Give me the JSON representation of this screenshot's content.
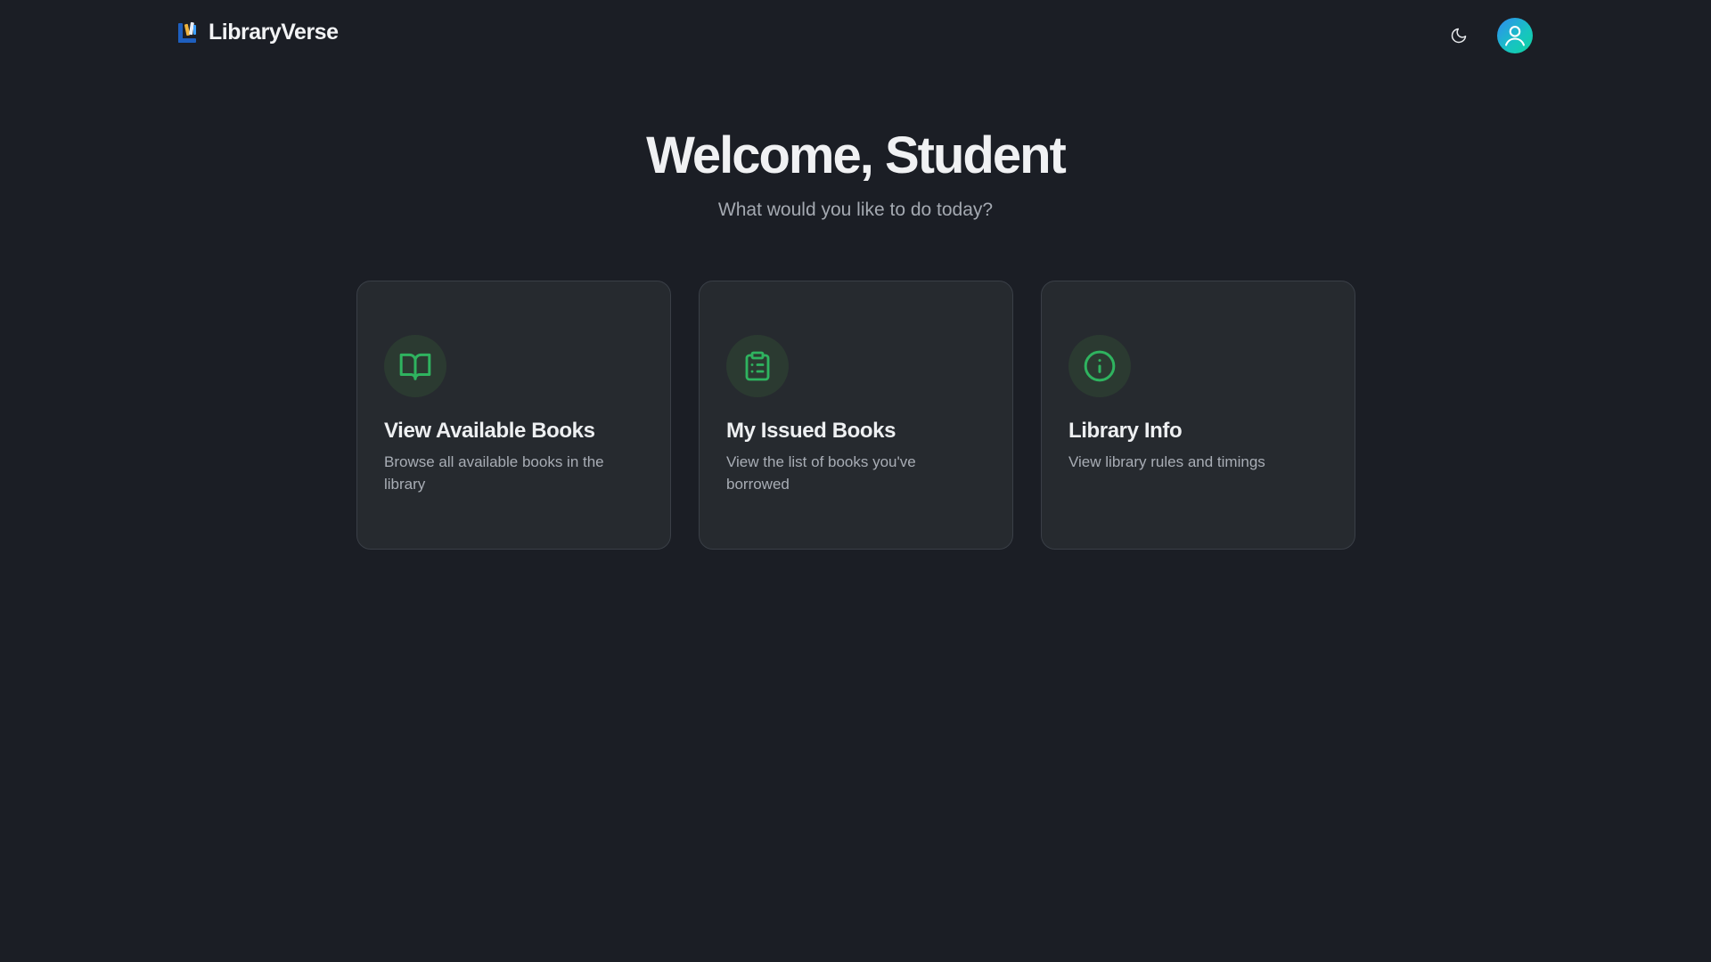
{
  "header": {
    "brand_name": "LibraryVerse",
    "theme_icon": "moon-icon",
    "avatar_icon": "user-icon"
  },
  "hero": {
    "title": "Welcome, Student",
    "subtitle": "What would you like to do today?"
  },
  "cards": [
    {
      "title": "View Available Books",
      "description": "Browse all available books in the library",
      "icon": "book-open-icon"
    },
    {
      "title": "My Issued Books",
      "description": "View the list of books you've borrowed",
      "icon": "clipboard-list-icon"
    },
    {
      "title": "Library Info",
      "description": "View library rules and timings",
      "icon": "info-icon"
    }
  ],
  "colors": {
    "background": "#1b1e25",
    "card_background": "#262a2f",
    "accent_green": "#2fb35f",
    "icon_circle": "#2b3a31",
    "avatar_gradient_start": "#2f8cf1",
    "avatar_gradient_end": "#10d39f"
  }
}
